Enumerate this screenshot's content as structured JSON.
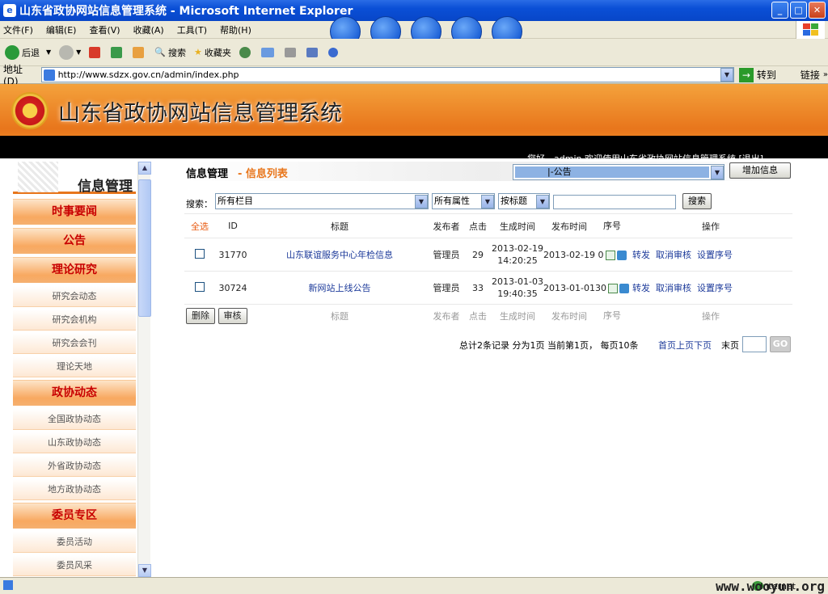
{
  "window": {
    "title": "山东省政协网站信息管理系统 - Microsoft Internet Explorer"
  },
  "menu": [
    "文件(F)",
    "编辑(E)",
    "查看(V)",
    "收藏(A)",
    "工具(T)",
    "帮助(H)"
  ],
  "toolbar": {
    "back": "后退",
    "search": "搜索",
    "favorites": "收藏夹"
  },
  "address": {
    "label": "地址(D)",
    "url": "http://www.sdzx.gov.cn/admin/index.php",
    "go": "转到",
    "links": "链接"
  },
  "banner": {
    "title": "山东省政协网站信息管理系统",
    "ticker": "您好，admin 欢迎使用山东省政协网站信息管理系统 [退出]"
  },
  "sidebar": {
    "heading": "信息管理",
    "items": [
      {
        "label": "时事要闻",
        "type": "main"
      },
      {
        "label": "公告",
        "type": "main"
      },
      {
        "label": "理论研究",
        "type": "main"
      },
      {
        "label": "研究会动态",
        "type": "sub"
      },
      {
        "label": "研究会机构",
        "type": "sub"
      },
      {
        "label": "研究会会刊",
        "type": "sub"
      },
      {
        "label": "理论天地",
        "type": "sub"
      },
      {
        "label": "政协动态",
        "type": "main"
      },
      {
        "label": "全国政协动态",
        "type": "sub"
      },
      {
        "label": "山东政协动态",
        "type": "sub"
      },
      {
        "label": "外省政协动态",
        "type": "sub"
      },
      {
        "label": "地方政协动态",
        "type": "sub"
      },
      {
        "label": "委员专区",
        "type": "main"
      },
      {
        "label": "委员活动",
        "type": "sub"
      },
      {
        "label": "委员风采",
        "type": "sub"
      }
    ]
  },
  "main": {
    "crumb1": "信息管理",
    "crumb2": "- 信息列表",
    "category": "|-公告",
    "add_button": "增加信息",
    "search_label": "搜索：",
    "col_filter": "所有栏目",
    "attr_filter": "所有属性",
    "by_filter": "按标题",
    "search_value": "",
    "search_button": "搜索"
  },
  "table": {
    "headers": {
      "select": "全选",
      "id": "ID",
      "title": "标题",
      "publisher": "发布者",
      "clicks": "点击",
      "created": "生成时间",
      "published": "发布时间",
      "order": "序号",
      "actions": "操作"
    },
    "footer_headers": {
      "id": "ID",
      "title": "标题",
      "publisher": "发布者",
      "clicks": "点击",
      "created": "生成时间",
      "published": "发布时间",
      "order": "序号",
      "actions": "操作"
    },
    "rows": [
      {
        "id": "31770",
        "title": "山东联谊服务中心年检信息",
        "publisher": "管理员",
        "clicks": "29",
        "created": "2013-02-19 14:20:25",
        "published": "2013-02-19",
        "order": "0",
        "forward": "转发",
        "unaudit": "取消审核",
        "setorder": "设置序号"
      },
      {
        "id": "30724",
        "title": "新网站上线公告",
        "publisher": "管理员",
        "clicks": "33",
        "created": "2013-01-03 19:40:35",
        "published": "2013-01-01",
        "order": "30",
        "forward": "转发",
        "unaudit": "取消审核",
        "setorder": "设置序号"
      }
    ],
    "delete_button": "删除",
    "audit_button": "审核"
  },
  "pager": {
    "summary": "总计2条记录  分为1页  当前第1页，  每页10条",
    "links": "首页上页下页",
    "last": "末页",
    "go": "GO",
    "page_value": ""
  },
  "status": {
    "zone": "Internet",
    "watermark": "www.wooyun.org"
  }
}
